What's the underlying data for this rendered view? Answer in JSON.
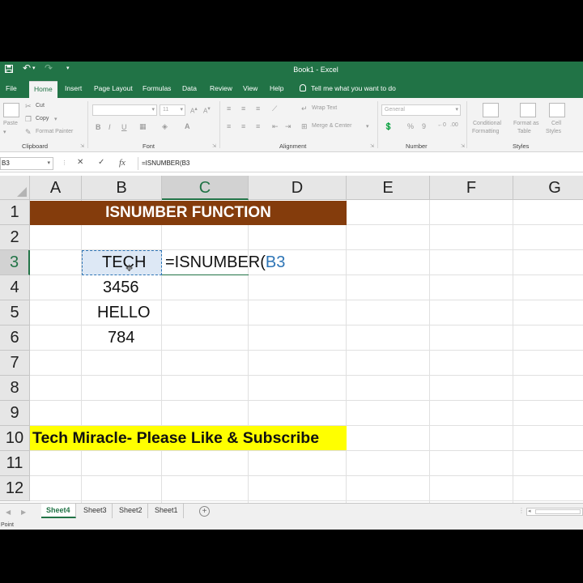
{
  "window": {
    "title": "Book1 - Excel",
    "quick_access": [
      "save-icon",
      "undo-icon",
      "redo-icon",
      "customize-icon"
    ]
  },
  "ribbon_tabs": [
    "File",
    "Home",
    "Insert",
    "Page Layout",
    "Formulas",
    "Data",
    "Review",
    "View",
    "Help"
  ],
  "active_tab": "Home",
  "tell_me": "Tell me what you want to do",
  "ribbon": {
    "clipboard": {
      "paste": "Paste",
      "cut": "Cut",
      "copy": "Copy",
      "format_painter": "Format Painter",
      "label": "Clipboard"
    },
    "font": {
      "font_name": "",
      "font_size": "11",
      "bold": "B",
      "italic": "I",
      "underline": "U",
      "label": "Font"
    },
    "alignment": {
      "wrap_text": "Wrap Text",
      "merge_center": "Merge & Center",
      "label": "Alignment"
    },
    "number": {
      "format": "General",
      "percent": "%",
      "comma": "9",
      "label": "Number"
    },
    "styles": {
      "conditional_formatting": [
        "Conditional",
        "Formatting"
      ],
      "format_as_table": [
        "Format as",
        "Table"
      ],
      "cell_styles": [
        "Cell",
        "Styles"
      ],
      "label": "Styles"
    }
  },
  "formula_bar": {
    "name_box": "B3",
    "formula": "=ISNUMBER(B3",
    "fx": "fx",
    "cancel": "✕",
    "enter": "✓"
  },
  "columns": [
    "A",
    "B",
    "C",
    "D",
    "E",
    "F",
    "G"
  ],
  "selected_column": "C",
  "rows": [
    "1",
    "2",
    "3",
    "4",
    "5",
    "6",
    "7",
    "8",
    "9",
    "10",
    "11",
    "12"
  ],
  "selected_row": "3",
  "cells": {
    "B1_merged": "ISNUMBER FUNCTION",
    "B3": "TECH",
    "B4": "3456",
    "B5": "HELLO",
    "B6": "784",
    "C3_formula_prefix": "=ISNUMBER(",
    "C3_formula_ref": "B3",
    "A10": "Tech Miracle- Please Like & Subscribe"
  },
  "colors": {
    "excel_green": "#217346",
    "title_fill": "#843c0c",
    "banner_fill": "#ffff00",
    "ref_blue": "#2e75b6"
  },
  "sheet_tabs": [
    "Sheet4",
    "Sheet3",
    "Sheet2",
    "Sheet1"
  ],
  "active_sheet": "Sheet4",
  "status": "Point"
}
